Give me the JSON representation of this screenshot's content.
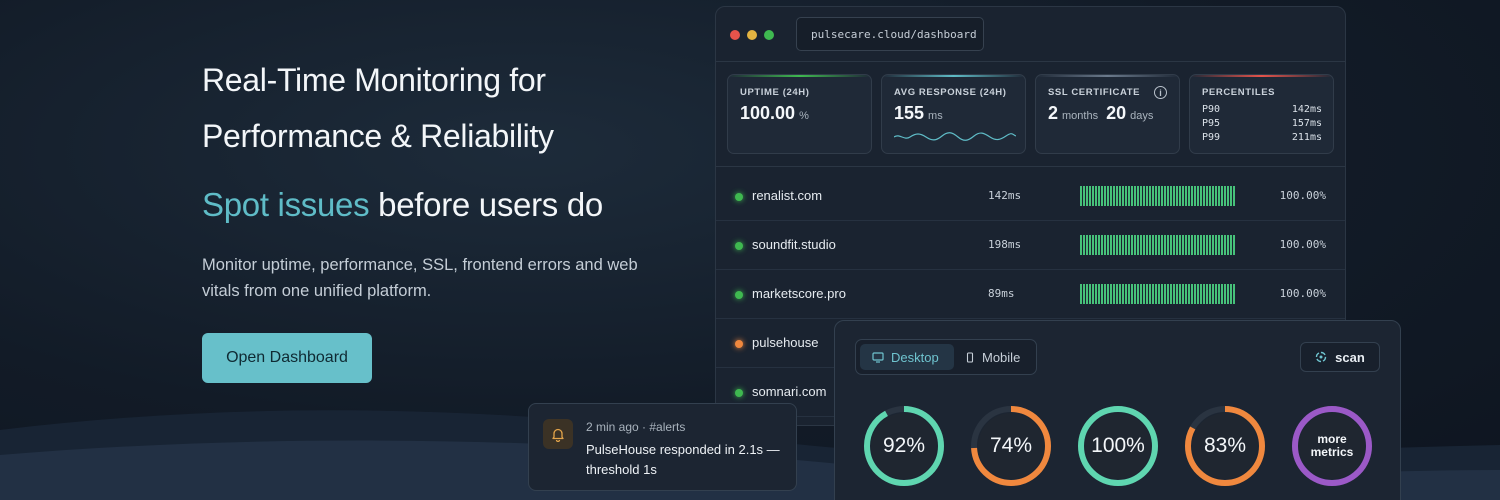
{
  "hero": {
    "title_line1": "Real-Time Monitoring for",
    "title_line2": "Performance & Reliability",
    "subtitle_accent": "Spot issues",
    "subtitle_rest": " before users do",
    "description": "Monitor uptime, performance, SSL, frontend errors and web vitals from one unified platform.",
    "cta_label": "Open Dashboard"
  },
  "window": {
    "url": "pulsecare.cloud/dashboard",
    "traffic_colors": [
      "#e5534b",
      "#e3b341",
      "#3fb950"
    ]
  },
  "cards": {
    "uptime": {
      "label": "UPTIME (24H)",
      "value": "100.00",
      "unit": "%"
    },
    "response": {
      "label": "AVG RESPONSE (24H)",
      "value": "155",
      "unit": "ms"
    },
    "ssl": {
      "label": "SSL CERTIFICATE",
      "months": "2",
      "months_unit": "months",
      "days": "20",
      "days_unit": "days",
      "info_icon": "i"
    },
    "percentiles": {
      "label": "PERCENTILES",
      "rows": [
        {
          "p": "P90",
          "v": "142ms"
        },
        {
          "p": "P95",
          "v": "157ms"
        },
        {
          "p": "P99",
          "v": "211ms"
        }
      ]
    }
  },
  "sites": [
    {
      "name": "renalist.com",
      "ms": "142ms",
      "uptime": "100.00%",
      "status_color": "#3fb950"
    },
    {
      "name": "soundfit.studio",
      "ms": "198ms",
      "uptime": "100.00%",
      "status_color": "#3fb950"
    },
    {
      "name": "marketscore.pro",
      "ms": "89ms",
      "uptime": "100.00%",
      "status_color": "#3fb950"
    },
    {
      "name": "pulsehouse",
      "ms": "",
      "uptime": "",
      "status_color": "#f0883e"
    },
    {
      "name": "somnari.com",
      "ms": "",
      "uptime": "",
      "status_color": "#3fb950"
    }
  ],
  "scan_panel": {
    "tab_desktop": "Desktop",
    "tab_mobile": "Mobile",
    "scan_label": "scan",
    "gauges": [
      {
        "label": "92%",
        "value": 0.92,
        "color": "#5fd6b0"
      },
      {
        "label": "74%",
        "value": 0.74,
        "color": "#f0883e"
      },
      {
        "label": "100%",
        "value": 1.0,
        "color": "#5fd6b0"
      },
      {
        "label": "83%",
        "value": 0.83,
        "color": "#f0883e"
      },
      {
        "label": "more metrics",
        "value": 1.0,
        "color": "#9b59c7"
      }
    ]
  },
  "alert": {
    "meta": "2 min ago · #alerts",
    "message": "PulseHouse responded in 2.1s — threshold 1s"
  },
  "colors": {
    "accent": "#5fbcc7",
    "cta_bg": "#67c0ca",
    "ok": "#3fb950",
    "warn": "#f0883e"
  }
}
